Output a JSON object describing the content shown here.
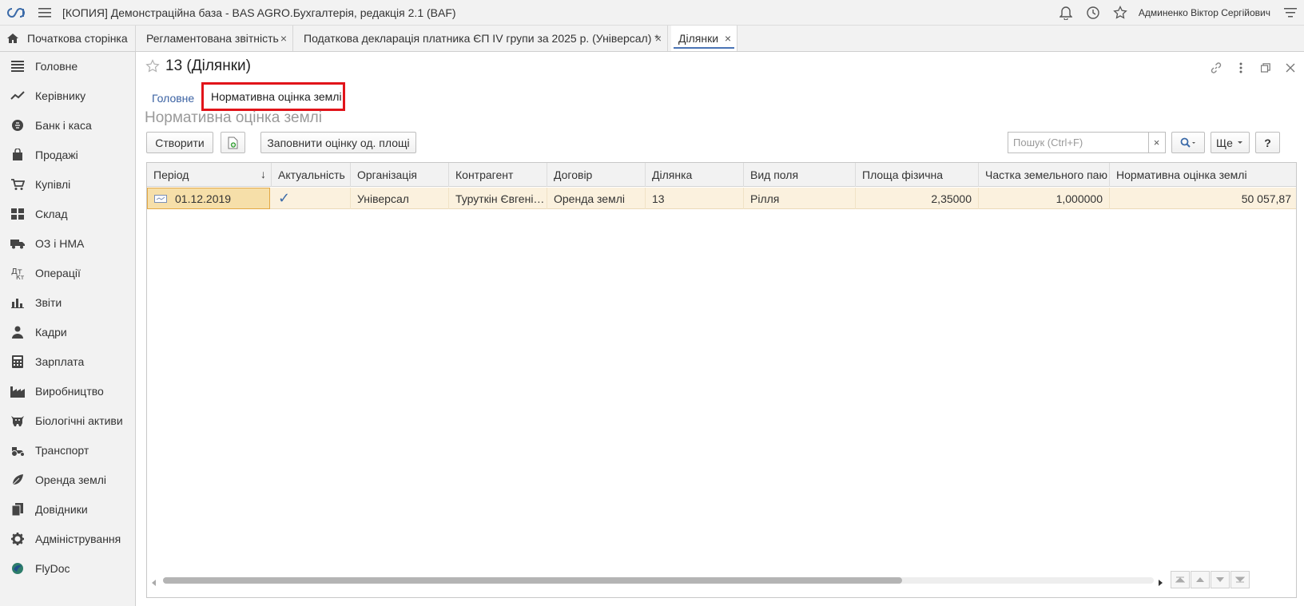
{
  "app": {
    "title": "[КОПИЯ] Демонстраційна база - BAS AGRO.Бухгалтерія, редакція 2.1  (BAF)",
    "user": "Админенко Віктор Сергійович",
    "logo_icon": "bas-logo-icon"
  },
  "tabs": {
    "home": "Початкова сторінка",
    "open": [
      {
        "label": "Регламентована звітність"
      },
      {
        "label": "Податкова декларація платника ЄП IV групи за 2025 р. (Універсал) *"
      },
      {
        "label": "Ділянки"
      }
    ],
    "close_glyph": "×"
  },
  "sidebar": {
    "items": [
      {
        "label": "Головне",
        "icon": "list-icon"
      },
      {
        "label": "Керівнику",
        "icon": "trend-icon"
      },
      {
        "label": "Банк і каса",
        "icon": "coin-icon"
      },
      {
        "label": "Продажі",
        "icon": "bag-icon"
      },
      {
        "label": "Купівлі",
        "icon": "cart-icon"
      },
      {
        "label": "Склад",
        "icon": "warehouse-icon"
      },
      {
        "label": "ОЗ і НМА",
        "icon": "truck-icon"
      },
      {
        "label": "Операції",
        "icon": "operations-icon"
      },
      {
        "label": "Звіти",
        "icon": "bar-chart-icon"
      },
      {
        "label": "Кадри",
        "icon": "person-icon"
      },
      {
        "label": "Зарплата",
        "icon": "calculator-icon"
      },
      {
        "label": "Виробництво",
        "icon": "factory-icon"
      },
      {
        "label": "Біологічні активи",
        "icon": "cow-icon"
      },
      {
        "label": "Транспорт",
        "icon": "tractor-icon"
      },
      {
        "label": "Оренда землі",
        "icon": "leaf-icon"
      },
      {
        "label": "Довідники",
        "icon": "books-icon"
      },
      {
        "label": "Адміністрування",
        "icon": "gear-icon"
      },
      {
        "label": "FlyDoc",
        "icon": "flydoc-icon"
      }
    ]
  },
  "form": {
    "title": "13 (Ділянки)",
    "section_tabs": {
      "main": "Головне",
      "selected": "Нормативна оцінка землі"
    },
    "group_title": "Нормативна оцінка землі",
    "toolbar": {
      "create": "Створити",
      "fill": "Заповнити оцінку од. площі",
      "search_placeholder": "Пошук (Ctrl+F)",
      "clear": "×",
      "more": "Ще",
      "help": "?"
    }
  },
  "grid": {
    "sort_glyph": "↓",
    "columns": [
      "Період",
      "Актуальність",
      "Організація",
      "Контрагент",
      "Договір",
      "Ділянка",
      "Вид поля",
      "Площа фізична",
      "Частка земельного паю",
      "Нормативна оцінка землі"
    ],
    "rows": [
      {
        "period": "01.12.2019",
        "actual": "✓",
        "org": "Універсал",
        "counterparty": "Туруткін Євгені…",
        "contract": "Оренда землі",
        "plot": "13",
        "field_type": "Рілля",
        "area": "2,35000",
        "share": "1,000000",
        "valuation": "50 057,87"
      }
    ]
  },
  "colors": {
    "accent": "#4a74b5",
    "highlight_border": "#e1141a",
    "row_selected": "#fbf1de"
  }
}
